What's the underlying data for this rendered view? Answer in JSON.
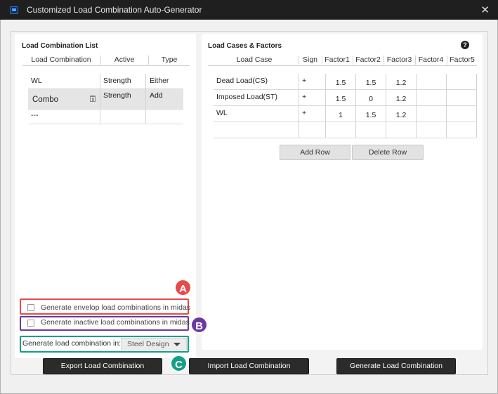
{
  "window": {
    "title": "Customized Load Combination Auto-Generator",
    "close_glyph": "✕",
    "app_icon": "midas-app-icon"
  },
  "left_panel": {
    "title": "Load Combination List",
    "columns": [
      "Load Combination",
      "Active",
      "Type"
    ],
    "rows": [
      {
        "name": "WL",
        "active": "Strength",
        "type": "Either"
      },
      {
        "name": "Combo",
        "active": "Strength",
        "type": "Add",
        "selected": true,
        "trash_icon": "trash-icon"
      },
      {
        "name": "---",
        "active": "",
        "type": ""
      }
    ],
    "options": {
      "envelop_label": "Generate envelop load combinations in midas",
      "envelop_checked": false,
      "inactive_label": "Generate inactive load combinations in midas",
      "inactive_checked": false,
      "generate_in_label": "Generate load combination in:",
      "generate_in_value": "Steel Design"
    }
  },
  "right_panel": {
    "title": "Load Cases & Factors",
    "help_glyph": "?",
    "columns": [
      "Load Case",
      "Sign",
      "Factor1",
      "Factor2",
      "Factor3",
      "Factor4",
      "Factor5"
    ],
    "rows": [
      [
        "Dead Load(CS)",
        "+",
        "1.5",
        "1.5",
        "1.2",
        "",
        ""
      ],
      [
        "Imposed Load(ST)",
        "+",
        "1.5",
        "0",
        "1.2",
        "",
        ""
      ],
      [
        "WL",
        "+",
        "1",
        "1.5",
        "1.2",
        "",
        ""
      ],
      [
        "",
        "",
        "",
        "",
        "",
        "",
        ""
      ]
    ],
    "add_row_label": "Add Row",
    "delete_row_label": "Delete Row"
  },
  "callouts": {
    "a": "A",
    "b": "B",
    "c": "C",
    "colors": {
      "a": "#e84a4a",
      "b": "#6b3aa0",
      "c": "#14a085"
    }
  },
  "footer": {
    "export_label": "Export Load Combination",
    "import_label": "Import Load Combination",
    "generate_label": "Generate Load Combination"
  }
}
